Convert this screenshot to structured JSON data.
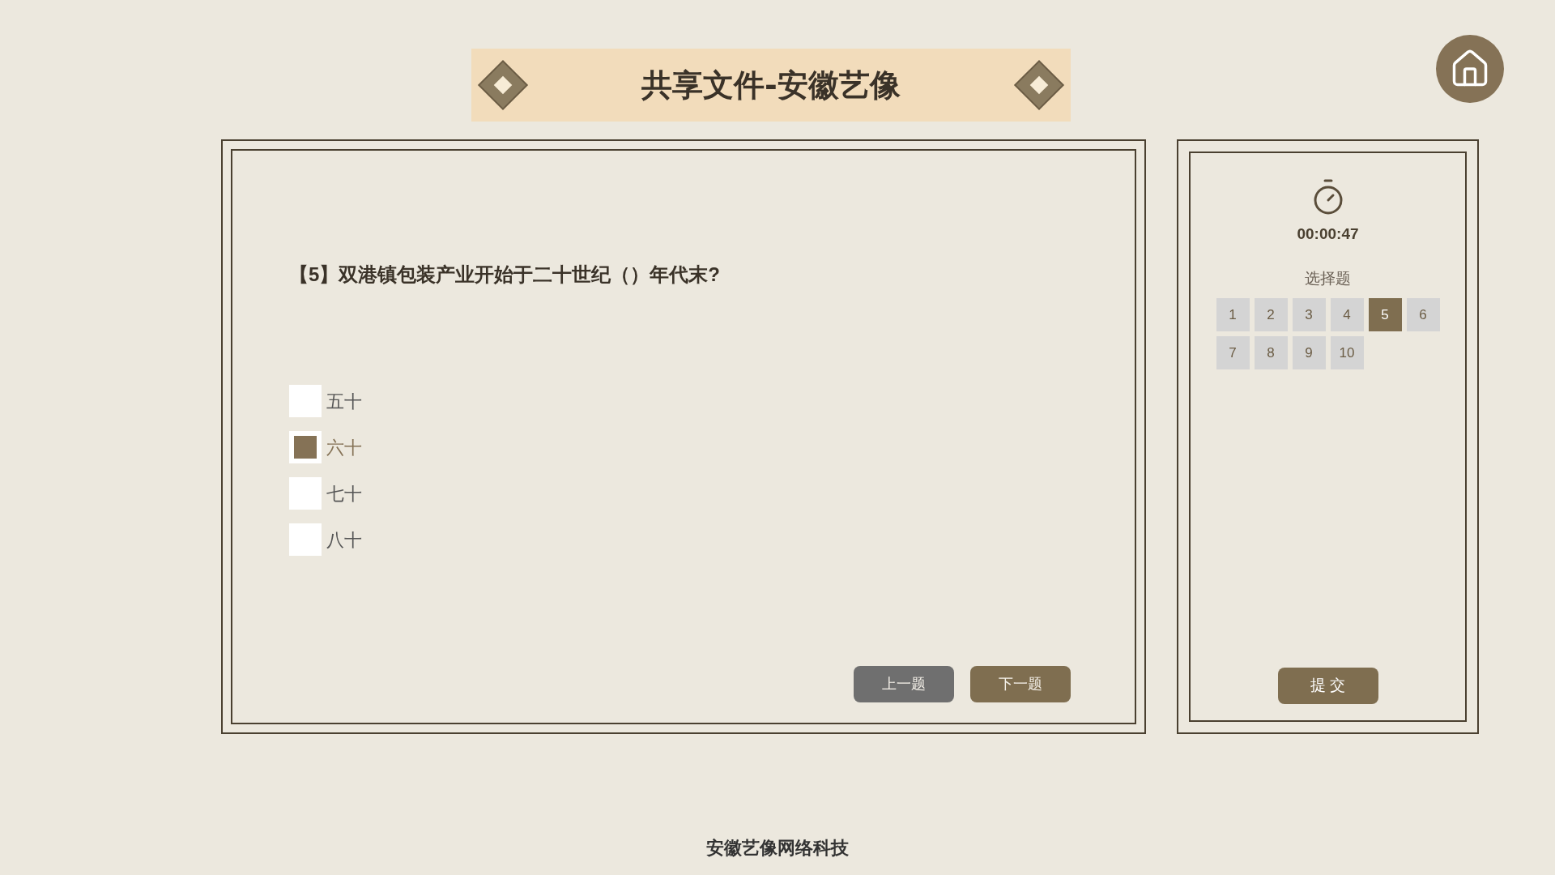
{
  "header": {
    "title": "共享文件-安徽艺像"
  },
  "question": {
    "text": "【5】双港镇包装产业开始于二十世纪（）年代末?",
    "options": [
      {
        "label": "五十",
        "selected": false
      },
      {
        "label": "六十",
        "selected": true
      },
      {
        "label": "七十",
        "selected": false
      },
      {
        "label": "八十",
        "selected": false
      }
    ]
  },
  "nav_buttons": [
    "上一题",
    "下一题"
  ],
  "sidebar": {
    "timer": "00:00:47",
    "section": "选择题",
    "questions": [
      {
        "label": "1",
        "selected": false
      },
      {
        "label": "2",
        "selected": false
      },
      {
        "label": "3",
        "selected": false
      },
      {
        "label": "4",
        "selected": false
      },
      {
        "label": "5",
        "selected": true
      },
      {
        "label": "6",
        "selected": false
      },
      {
        "label": "7",
        "selected": false
      },
      {
        "label": "8",
        "selected": false
      },
      {
        "label": "9",
        "selected": false
      },
      {
        "label": "10",
        "selected": false
      }
    ],
    "submit": "提 交"
  },
  "footer": "安徽艺像网络科技"
}
